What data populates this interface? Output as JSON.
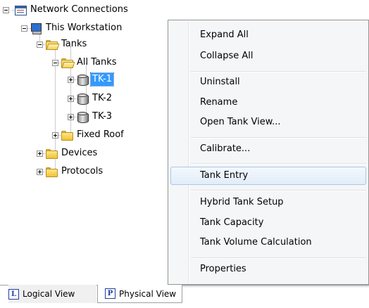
{
  "tree": {
    "root": "Network Connections",
    "workstation": "This Workstation",
    "tanks": "Tanks",
    "all_tanks": "All Tanks",
    "tk1": "TK-1",
    "tk2": "TK-2",
    "tk3": "TK-3",
    "fixed_roof": "Fixed Roof",
    "devices": "Devices",
    "protocols": "Protocols",
    "selected": "TK-1"
  },
  "context_menu": {
    "items": [
      "Expand All",
      "Collapse All",
      "Uninstall",
      "Rename",
      "Open Tank View...",
      "Calibrate...",
      "Tank Entry",
      "Hybrid Tank Setup",
      "Tank Capacity",
      "Tank Volume Calculation",
      "Properties"
    ],
    "highlighted": "Tank Entry"
  },
  "tabs": {
    "logical_letter": "L",
    "logical_label": "Logical View",
    "physical_letter": "P",
    "physical_label": "Physical View",
    "active": "Physical View"
  },
  "colors": {
    "selection": "#3399ff",
    "menu_background": "#f5f6f7",
    "menu_highlight_border": "#a8c8eb",
    "folder": "#f1c232"
  }
}
